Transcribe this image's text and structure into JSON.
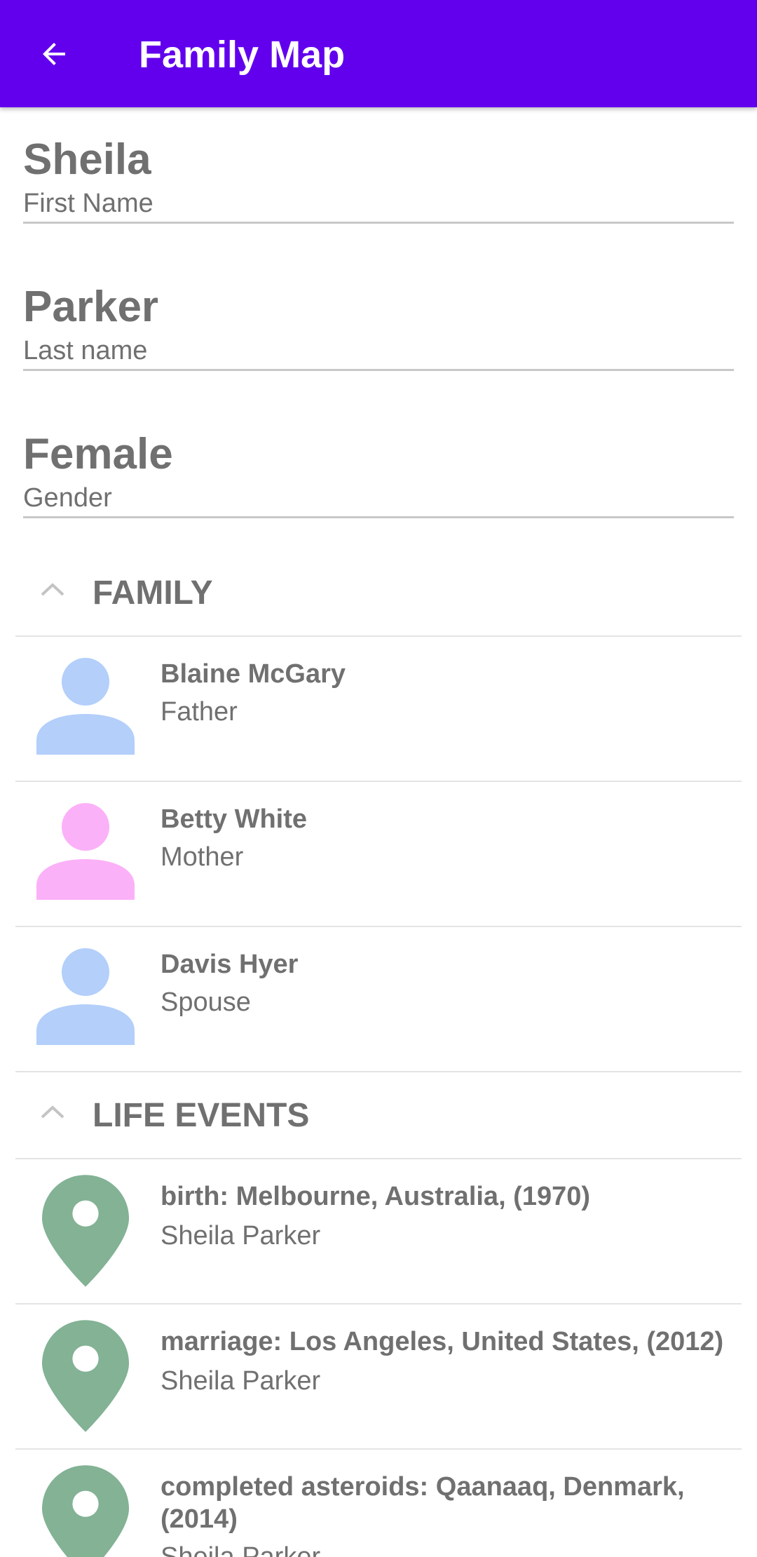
{
  "app_bar": {
    "title": "Family Map",
    "back_icon": "arrow-back-icon"
  },
  "person": {
    "first_name": {
      "value": "Sheila",
      "label": "First Name"
    },
    "last_name": {
      "value": "Parker",
      "label": "Last name"
    },
    "gender": {
      "value": "Female",
      "label": "Gender"
    }
  },
  "family": {
    "title": "FAMILY",
    "members": [
      {
        "name": "Blaine McGary",
        "relation": "Father",
        "icon": "male-person-icon",
        "color": "#b3cffa"
      },
      {
        "name": "Betty White",
        "relation": "Mother",
        "icon": "female-person-icon",
        "color": "#fbb1f8"
      },
      {
        "name": "Davis Hyer",
        "relation": "Spouse",
        "icon": "male-person-icon",
        "color": "#b3cffa"
      }
    ]
  },
  "life_events": {
    "title": "LIFE EVENTS",
    "events": [
      {
        "description": "birth: Melbourne, Australia, (1970)",
        "person": "Sheila Parker",
        "icon": "map-marker-icon",
        "color": "#83b295"
      },
      {
        "description": "marriage: Los Angeles, United States, (2012)",
        "person": "Sheila Parker",
        "icon": "map-marker-icon",
        "color": "#83b295"
      },
      {
        "description": "completed asteroids: Qaanaaq, Denmark, (2014)",
        "person": "Sheila Parker",
        "icon": "map-marker-icon",
        "color": "#83b295"
      }
    ]
  },
  "colors": {
    "app_bar": "#6200ee",
    "text": "#707070",
    "male": "#b3cffa",
    "female": "#fbb1f8",
    "event": "#83b295"
  }
}
